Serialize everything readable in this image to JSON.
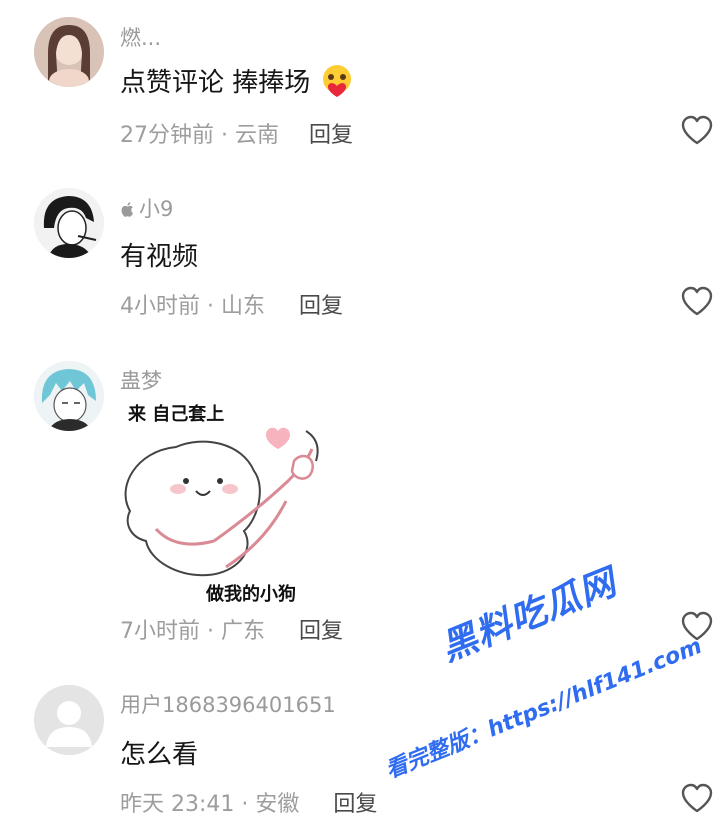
{
  "comments": [
    {
      "username": "燃...",
      "content": "点赞评论 捧捧场",
      "emoji_icon": "blushing-heart-emoji",
      "meta": "27分钟前 · 云南",
      "reply_label": "回复",
      "avatar_icon": "user-avatar-photo"
    },
    {
      "username": "小9",
      "username_prefix_icon": "apple-icon",
      "content": "有视频",
      "meta": "4小时前 · 山东",
      "reply_label": "回复",
      "avatar_icon": "user-avatar-sketch"
    },
    {
      "username": "蛊梦",
      "content_sticker": {
        "caption_top": "来 自己套上",
        "caption_bottom": "做我的小狗",
        "icon": "puppy-leash-sticker"
      },
      "meta": "7小时前 · 广东",
      "reply_label": "回复",
      "avatar_icon": "user-avatar-anime"
    },
    {
      "username": "用户1868396401651",
      "content": "怎么看",
      "meta": "昨天 23:41 · 安徽",
      "reply_label": "回复",
      "avatar_icon": "default-avatar"
    }
  ],
  "watermark": {
    "title": "黑料吃瓜网",
    "subtitle": "看完整版：https://hlf141.com"
  },
  "colors": {
    "username": "#9a9a9a",
    "content": "#161616",
    "meta": "#9d9d9d",
    "watermark": "#2f6cf0"
  }
}
